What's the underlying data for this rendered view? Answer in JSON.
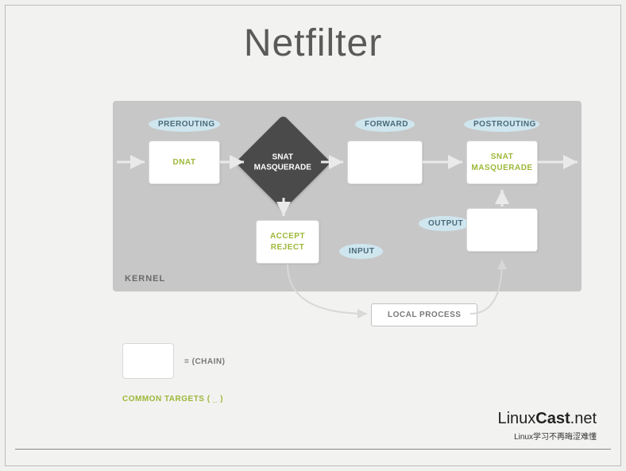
{
  "title": "Netfilter",
  "kernel": {
    "label": "KERNEL",
    "hooks": {
      "prerouting": "PREROUTING",
      "forward": "FORWARD",
      "postrouting": "POSTROUTING",
      "input": "INPUT",
      "output": "OUTPUT"
    },
    "diamond": {
      "line1": "SNAT",
      "line2": "MASQUERADE"
    },
    "chains": {
      "dnat": "DNAT",
      "accept": "ACCEPT",
      "reject": "REJECT",
      "snat_line1": "SNAT",
      "snat_line2": "MASQUERADE"
    }
  },
  "local_process": "LOCAL PROCESS",
  "legend": {
    "eq": "= (CHAIN)"
  },
  "common_targets": "COMMON TARGETS ( _ )",
  "logo": {
    "part1": "Linux",
    "part2": "Cast",
    "part3": ".net",
    "tagline": "Linux学习不再晦涩难懂"
  }
}
